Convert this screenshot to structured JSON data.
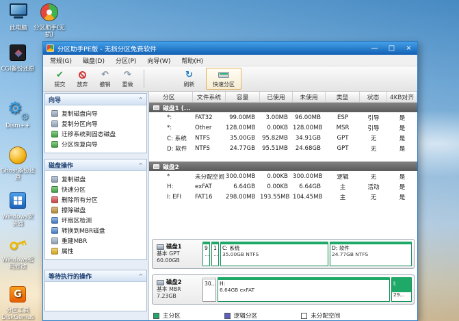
{
  "desktop": {
    "icons": [
      {
        "name": "this-pc",
        "label": "此电脑"
      },
      {
        "name": "partition-assistant",
        "label": "分区助手(无损)"
      },
      {
        "name": "cgi-backup",
        "label": "CGI备份还原"
      },
      {
        "name": "dism",
        "label": "Dism++"
      },
      {
        "name": "ghost-backup",
        "label": "Ghost备份还原"
      },
      {
        "name": "windows-installer",
        "label": "Windows安装器"
      },
      {
        "name": "windows-password",
        "label": "Windows密码修改"
      },
      {
        "name": "diskgenius",
        "label": "分区工具DiskGenius",
        "glyph": "G"
      }
    ]
  },
  "window": {
    "title": "分区助手PE版 - 无损分区免费软件",
    "controls": {
      "minimize": "—",
      "maximize": "□",
      "close": "×"
    },
    "menu": [
      {
        "label": "常规(G)"
      },
      {
        "label": "磁盘(D)"
      },
      {
        "label": "分区(P)"
      },
      {
        "label": "向导(W)"
      },
      {
        "label": "帮助(H)"
      }
    ],
    "toolbar": {
      "buttons": [
        {
          "label": "提交",
          "icon": "commit-icon"
        },
        {
          "label": "放弃",
          "icon": "discard-icon"
        },
        {
          "label": "撤销",
          "icon": "undo-icon"
        },
        {
          "label": "重做",
          "icon": "redo-icon"
        },
        {
          "label": "刷新",
          "icon": "refresh-icon"
        },
        {
          "label": "快速分区",
          "icon": "quick-partition-icon"
        }
      ]
    }
  },
  "sidebar": {
    "sections": [
      {
        "title": "向导",
        "items": [
          {
            "label": "复制磁盘向导",
            "icon": "copy-disk-wizard-icon"
          },
          {
            "label": "复制分区向导",
            "icon": "copy-partition-wizard-icon"
          },
          {
            "label": "迁移系统到固态磁盘",
            "icon": "migrate-os-icon"
          },
          {
            "label": "分区恢复向导",
            "icon": "partition-recovery-icon"
          }
        ]
      },
      {
        "title": "磁盘操作",
        "items": [
          {
            "label": "复制磁盘",
            "icon": "copy-disk-icon"
          },
          {
            "label": "快速分区",
            "icon": "quick-partition-icon"
          },
          {
            "label": "删除所有分区",
            "icon": "delete-all-partitions-icon"
          },
          {
            "label": "擦除磁盘",
            "icon": "wipe-disk-icon"
          },
          {
            "label": "坏扇区检测",
            "icon": "bad-sector-test-icon"
          },
          {
            "label": "转换到MBR磁盘",
            "icon": "convert-to-mbr-icon"
          },
          {
            "label": "重建MBR",
            "icon": "rebuild-mbr-icon"
          },
          {
            "label": "属性",
            "icon": "properties-icon"
          }
        ]
      },
      {
        "title": "等待执行的操作",
        "items": []
      }
    ]
  },
  "table": {
    "columns": [
      "分区",
      "文件系统",
      "容量",
      "已使用",
      "未使用",
      "类型",
      "状态",
      "4KB对齐"
    ],
    "disk1": {
      "name": "磁盘1 (...",
      "rows": [
        {
          "partition": "*:",
          "fs": "FAT32",
          "capacity": "99.00MB",
          "used": "3.00MB",
          "free": "96.00MB",
          "type": "ESP",
          "status": "引导",
          "aligned": "是"
        },
        {
          "partition": "*:",
          "fs": "Other",
          "capacity": "128.00MB",
          "used": "0.00KB",
          "free": "128.00MB",
          "type": "MSR",
          "status": "引导",
          "aligned": "是"
        },
        {
          "partition": "C: 系统",
          "fs": "NTFS",
          "capacity": "35.00GB",
          "used": "95.82MB",
          "free": "34.91GB",
          "type": "GPT",
          "status": "无",
          "aligned": "是"
        },
        {
          "partition": "D: 软件",
          "fs": "NTFS",
          "capacity": "24.77GB",
          "used": "95.51MB",
          "free": "24.68GB",
          "type": "GPT",
          "status": "无",
          "aligned": "是"
        }
      ]
    },
    "disk2": {
      "name": "磁盘2",
      "rows": [
        {
          "partition": "*",
          "fs": "未分配空间",
          "capacity": "300.00MB",
          "used": "0.00KB",
          "free": "300.00MB",
          "type": "逻辑",
          "status": "无",
          "aligned": "是"
        },
        {
          "partition": "H:",
          "fs": "exFAT",
          "capacity": "6.64GB",
          "used": "0.00KB",
          "free": "6.64GB",
          "type": "主",
          "status": "活动",
          "aligned": "是"
        },
        {
          "partition": "I: EFI",
          "fs": "FAT16",
          "capacity": "298.00MB",
          "used": "193.55MB",
          "free": "104.45MB",
          "type": "主",
          "status": "无",
          "aligned": "是"
        }
      ]
    }
  },
  "disk_graphics": {
    "disk1": {
      "name": "磁盘1",
      "scheme": "基本 GPT",
      "size": "60.00GB",
      "segments": [
        {
          "label": "9",
          "sub": "…",
          "kind": "primary"
        },
        {
          "label": "1",
          "sub": "…",
          "kind": "primary"
        },
        {
          "label": "C: 系统",
          "sub": "35.00GB NTFS",
          "kind": "primary"
        },
        {
          "label": "D: 软件",
          "sub": "24.77GB NTFS",
          "kind": "primary"
        }
      ]
    },
    "disk2": {
      "name": "磁盘2",
      "scheme": "基本 MBR",
      "size": "7.23GB",
      "segments": [
        {
          "label": "30…",
          "sub": "",
          "kind": "unallocated"
        },
        {
          "label": "H:",
          "sub": "6.64GB exFAT",
          "kind": "primary"
        },
        {
          "label": "I:",
          "sub": "29…",
          "kind": "primary-filled"
        }
      ]
    }
  },
  "legend": [
    {
      "label": "主分区",
      "color": "#1fa968"
    },
    {
      "label": "逻辑分区",
      "color": "#5a5fc0"
    },
    {
      "label": "未分配空间",
      "color": "#ffffff"
    }
  ],
  "colors": {
    "titlebar_blue": "#1d7bd6",
    "primary_green": "#1fa968",
    "logical_blue": "#5a5fc0",
    "group_row_gray": "#636363"
  }
}
